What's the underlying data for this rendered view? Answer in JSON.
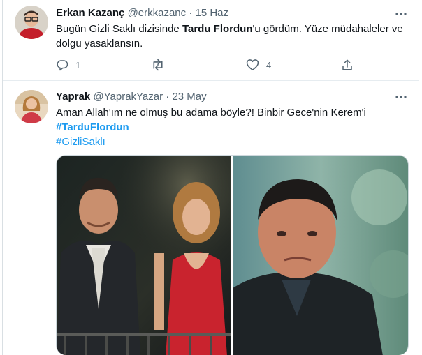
{
  "tweets": [
    {
      "name": "Erkan Kazanç",
      "handle": "@erkkazanc",
      "dot": "·",
      "date": "15 Haz",
      "text_pre": "Bugün Gizli Saklı dizisinde ",
      "text_bold": "Tardu Flordun",
      "text_post": "'u gördüm. Yüze müdahaleler ve dolgu yasaklansın.",
      "replies": "1",
      "retweets": "",
      "likes": "4"
    },
    {
      "name": "Yaprak",
      "handle": "@YaprakYazar",
      "dot": "·",
      "date": "23 May",
      "text": "Aman Allah'ım ne olmuş bu adama böyle?! Binbir Gece'nin Kerem'i",
      "hashtag1": "#TarduFlordun",
      "hashtag2": "#GizliSaklı"
    }
  ],
  "colors": {
    "accent": "#1d9bf0",
    "muted": "#536471",
    "text": "#0f1419",
    "border": "#e6ecf0"
  },
  "icons": [
    "more-icon",
    "reply-icon",
    "retweet-icon",
    "like-icon",
    "share-icon"
  ]
}
